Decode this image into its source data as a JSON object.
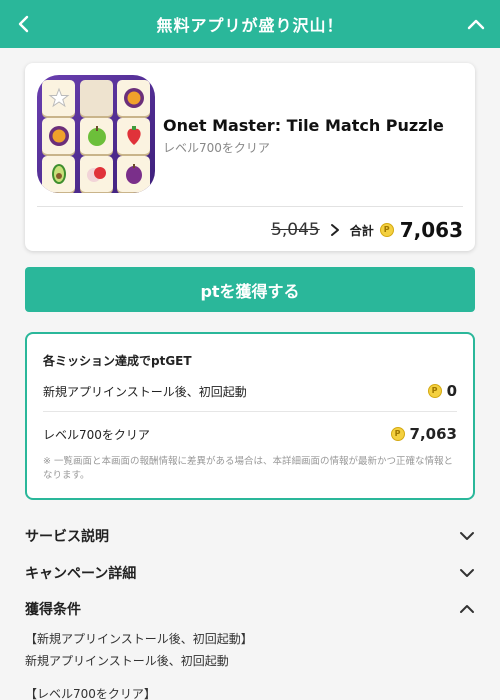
{
  "header": {
    "title": "無料アプリが盛り沢山！"
  },
  "app": {
    "name": "Onet Master: Tile Match Puzzle",
    "subtitle": "レベル700をクリア",
    "old_points": "5,045",
    "total_label": "合計",
    "total_points": "7,063",
    "icon": "fruit-tiles-app-icon"
  },
  "actions": {
    "get_points_label": "ptを獲得する"
  },
  "missions": {
    "title": "各ミッション達成でptGET",
    "items": [
      {
        "label": "新規アプリインストール後、初回起動",
        "points": "0"
      },
      {
        "label": "レベル700をクリア",
        "points": "7,063"
      }
    ],
    "note": "※ 一覧画面と本画面の報酬情報に差異がある場合は、本詳細画面の情報が最新かつ正確な情報となります。"
  },
  "sections": {
    "service": "サービス説明",
    "campaign": "キャンペーン詳細",
    "conditions": "獲得条件"
  },
  "conditions": {
    "item1_heading": "【新規アプリインストール後、初回起動】",
    "item1_text": "新規アプリインストール後、初回起動",
    "item2_heading": "【レベル700をクリア】"
  },
  "colors": {
    "accent": "#2ab79a",
    "coin": "#f4d03f"
  }
}
